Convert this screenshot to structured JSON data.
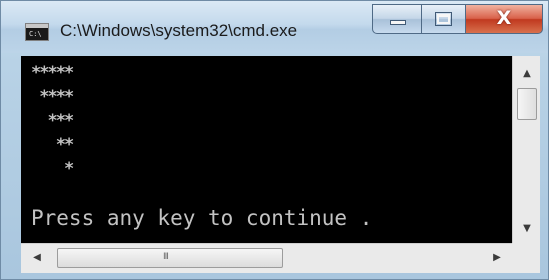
{
  "window": {
    "title": "C:\\Windows\\system32\\cmd.exe",
    "icon": "cmd-icon",
    "icon_text": "C:\\"
  },
  "controls": {
    "minimize_icon": "minimize-icon",
    "maximize_icon": "maximize-icon",
    "close_icon": "close-icon",
    "close_glyph": "X"
  },
  "console": {
    "lines": [
      "*****",
      " ****",
      "  ***",
      "   **",
      "    *"
    ],
    "prompt": "Press any key to continue ."
  },
  "scrollbars": {
    "up_glyph": "▲",
    "down_glyph": "▼",
    "left_glyph": "◀",
    "right_glyph": "▶",
    "grip": "III"
  },
  "colors": {
    "console_bg": "#000000",
    "console_text": "#c2c2c2",
    "close_button": "#c8452a"
  }
}
